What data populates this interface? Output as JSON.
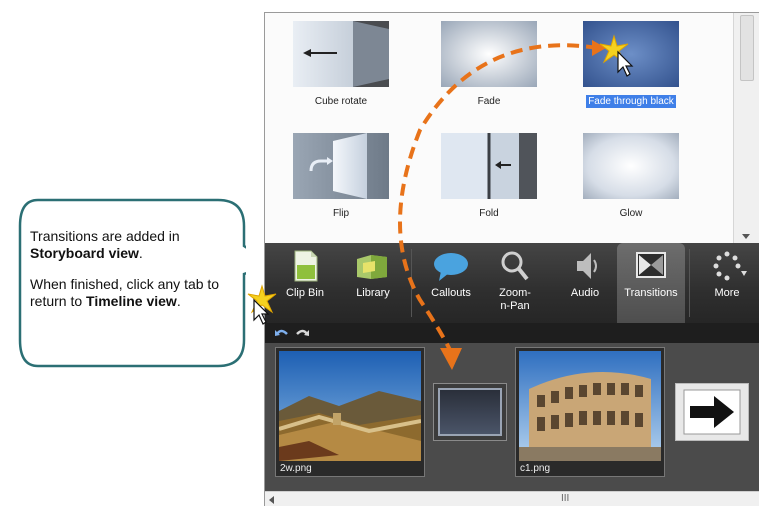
{
  "transitions": [
    {
      "name": "Cube rotate",
      "selected": false
    },
    {
      "name": "Fade",
      "selected": false
    },
    {
      "name": "Fade through black",
      "selected": true
    },
    {
      "name": "Flip",
      "selected": false
    },
    {
      "name": "Fold",
      "selected": false
    },
    {
      "name": "Glow",
      "selected": false
    }
  ],
  "tabs": [
    {
      "label": "Clip Bin",
      "icon": "clip-bin-icon"
    },
    {
      "label": "Library",
      "icon": "library-icon"
    },
    {
      "label": "Callouts",
      "icon": "callouts-icon"
    },
    {
      "label": "Zoom-n-Pan",
      "icon": "zoom-icon"
    },
    {
      "label": "Audio",
      "icon": "audio-icon"
    },
    {
      "label": "Transitions",
      "icon": "transitions-icon",
      "active": true
    },
    {
      "label": "More",
      "icon": "more-icon"
    }
  ],
  "toolbar": {
    "undo": "undo-icon",
    "redo": "redo-icon"
  },
  "clips": [
    {
      "name": "2w.png"
    },
    {
      "name": ""
    },
    {
      "name": "c1.png"
    },
    {
      "name": ""
    }
  ],
  "callout": {
    "line1_pre": "Transitions are added in ",
    "line1_bold": "Storyboard view",
    "line1_post": ".",
    "line2_pre": "When finished, click any tab to return to ",
    "line2_bold": "Timeline view",
    "line2_post": "."
  },
  "scrollbar": {
    "grip": "III"
  },
  "colors": {
    "selection": "#3f7fe8",
    "arrow": "#e8731a",
    "callout_border": "#2b6f74",
    "tabbar": "#333333"
  }
}
